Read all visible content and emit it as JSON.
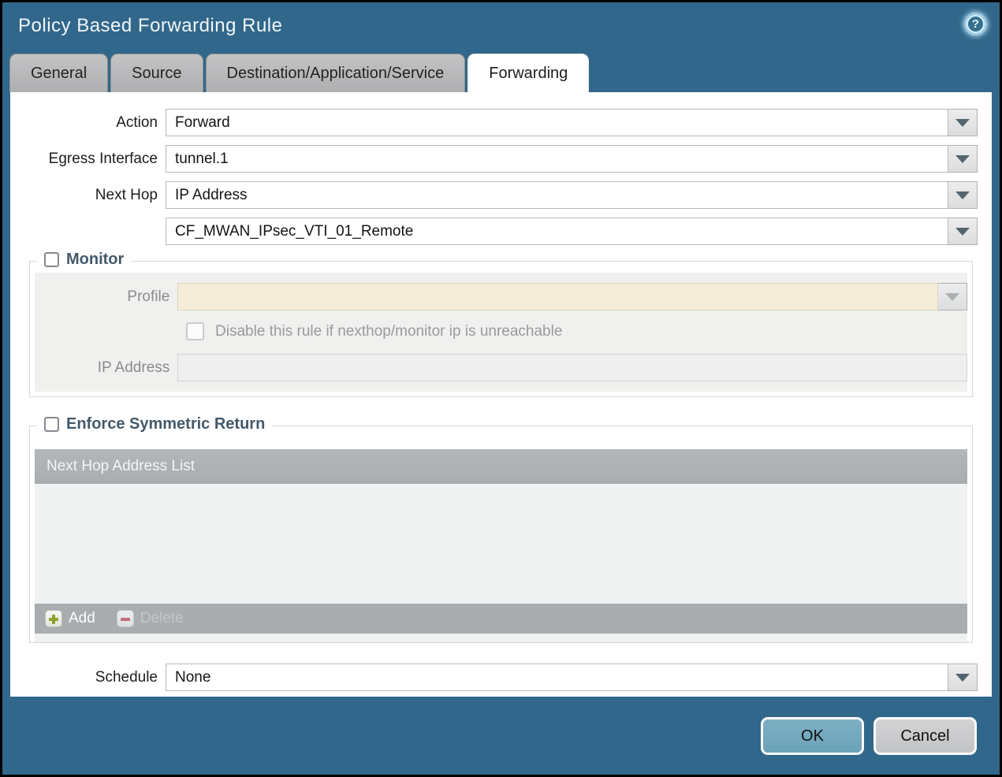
{
  "dialog": {
    "title": "Policy Based Forwarding Rule",
    "help_glyph": "?"
  },
  "tabs": [
    {
      "label": "General",
      "active": false
    },
    {
      "label": "Source",
      "active": false
    },
    {
      "label": "Destination/Application/Service",
      "active": false
    },
    {
      "label": "Forwarding",
      "active": true
    }
  ],
  "form": {
    "action": {
      "label": "Action",
      "value": "Forward"
    },
    "egress_interface": {
      "label": "Egress Interface",
      "value": "tunnel.1"
    },
    "next_hop": {
      "label": "Next Hop",
      "value": "IP Address"
    },
    "next_hop_address": {
      "value": "CF_MWAN_IPsec_VTI_01_Remote"
    },
    "schedule": {
      "label": "Schedule",
      "value": "None"
    }
  },
  "monitor": {
    "legend": "Monitor",
    "checked": false,
    "profile": {
      "label": "Profile",
      "value": ""
    },
    "disable_rule": {
      "label": "Disable this rule if nexthop/monitor ip is unreachable",
      "checked": false
    },
    "ip_address": {
      "label": "IP Address",
      "value": ""
    }
  },
  "symmetric_return": {
    "legend": "Enforce Symmetric Return",
    "checked": false,
    "table": {
      "header": "Next Hop Address List",
      "rows": []
    },
    "toolbar": {
      "add_label": "Add",
      "delete_label": "Delete",
      "delete_enabled": false
    }
  },
  "footer": {
    "ok_label": "OK",
    "cancel_label": "Cancel"
  },
  "colors": {
    "titlebar_teal": "#31678a",
    "ok_button": "#6fa6bc",
    "cancel_button": "#c9cacb",
    "profile_disabled_bg": "#f5ecd9",
    "table_header_bg": "#aeb2b5",
    "toolbar_bg": "#a9adb0",
    "add_plus_green": "#8da32b",
    "delete_minus_pink": "#c06d7d",
    "legend_text": "#44596b"
  }
}
